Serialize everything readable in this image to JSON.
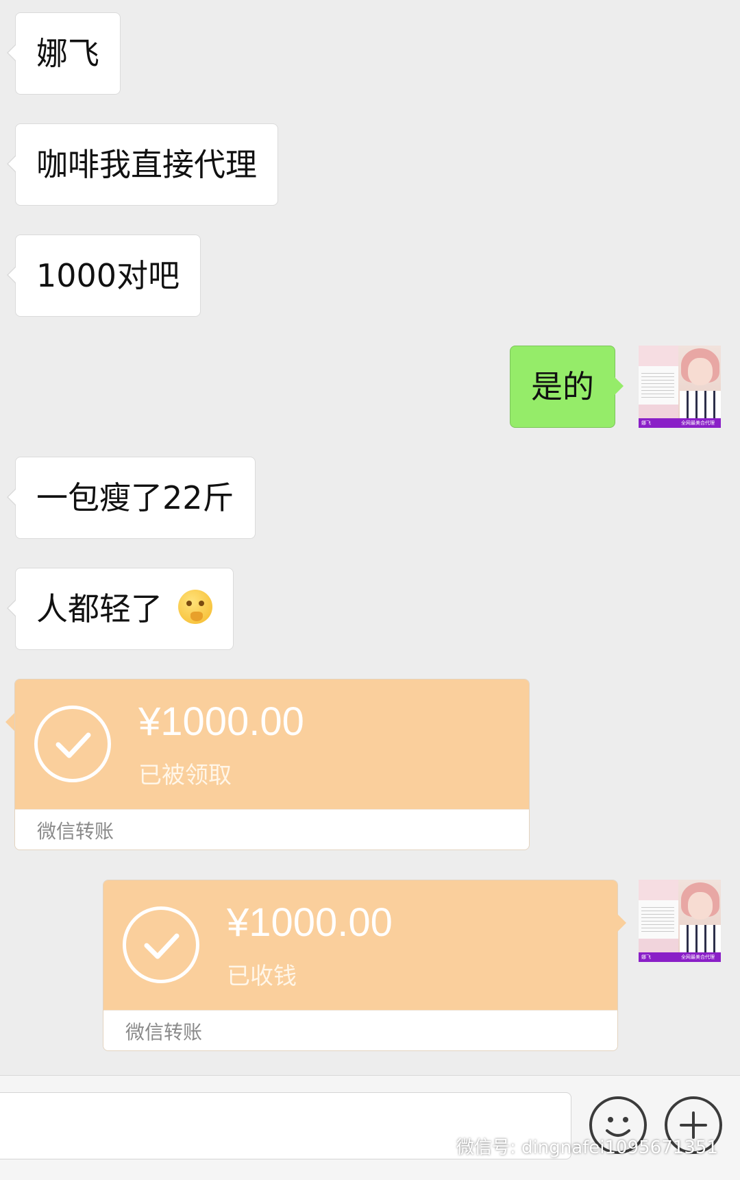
{
  "messages": [
    {
      "text": "娜飞"
    },
    {
      "text": "咖啡我直接代理"
    },
    {
      "text": "1000对吧"
    },
    {
      "text": "是的"
    },
    {
      "text": "一包瘦了22斤"
    },
    {
      "text": "人都轻了"
    }
  ],
  "transfers": [
    {
      "amount": "¥1000.00",
      "status": "已被领取",
      "label": "微信转账"
    },
    {
      "amount": "¥1000.00",
      "status": "已收钱",
      "label": "微信转账"
    }
  ],
  "avatar": {
    "tag": "娜飞",
    "caption": "全网最美合代理"
  },
  "input_bar": {
    "placeholder": ""
  },
  "watermark": {
    "text": "微信号: dingnafei1095671351"
  },
  "icons": {
    "emoji_reaction": "thinking-face-icon",
    "check": "check-circle-icon",
    "emoji_button": "smiley-icon",
    "plus_button": "plus-icon",
    "wechat": "wechat-logo-icon"
  },
  "colors": {
    "background": "#ededed",
    "bubble_self": "#95ec69",
    "bubble_other": "#ffffff",
    "transfer": "#facf9c"
  }
}
